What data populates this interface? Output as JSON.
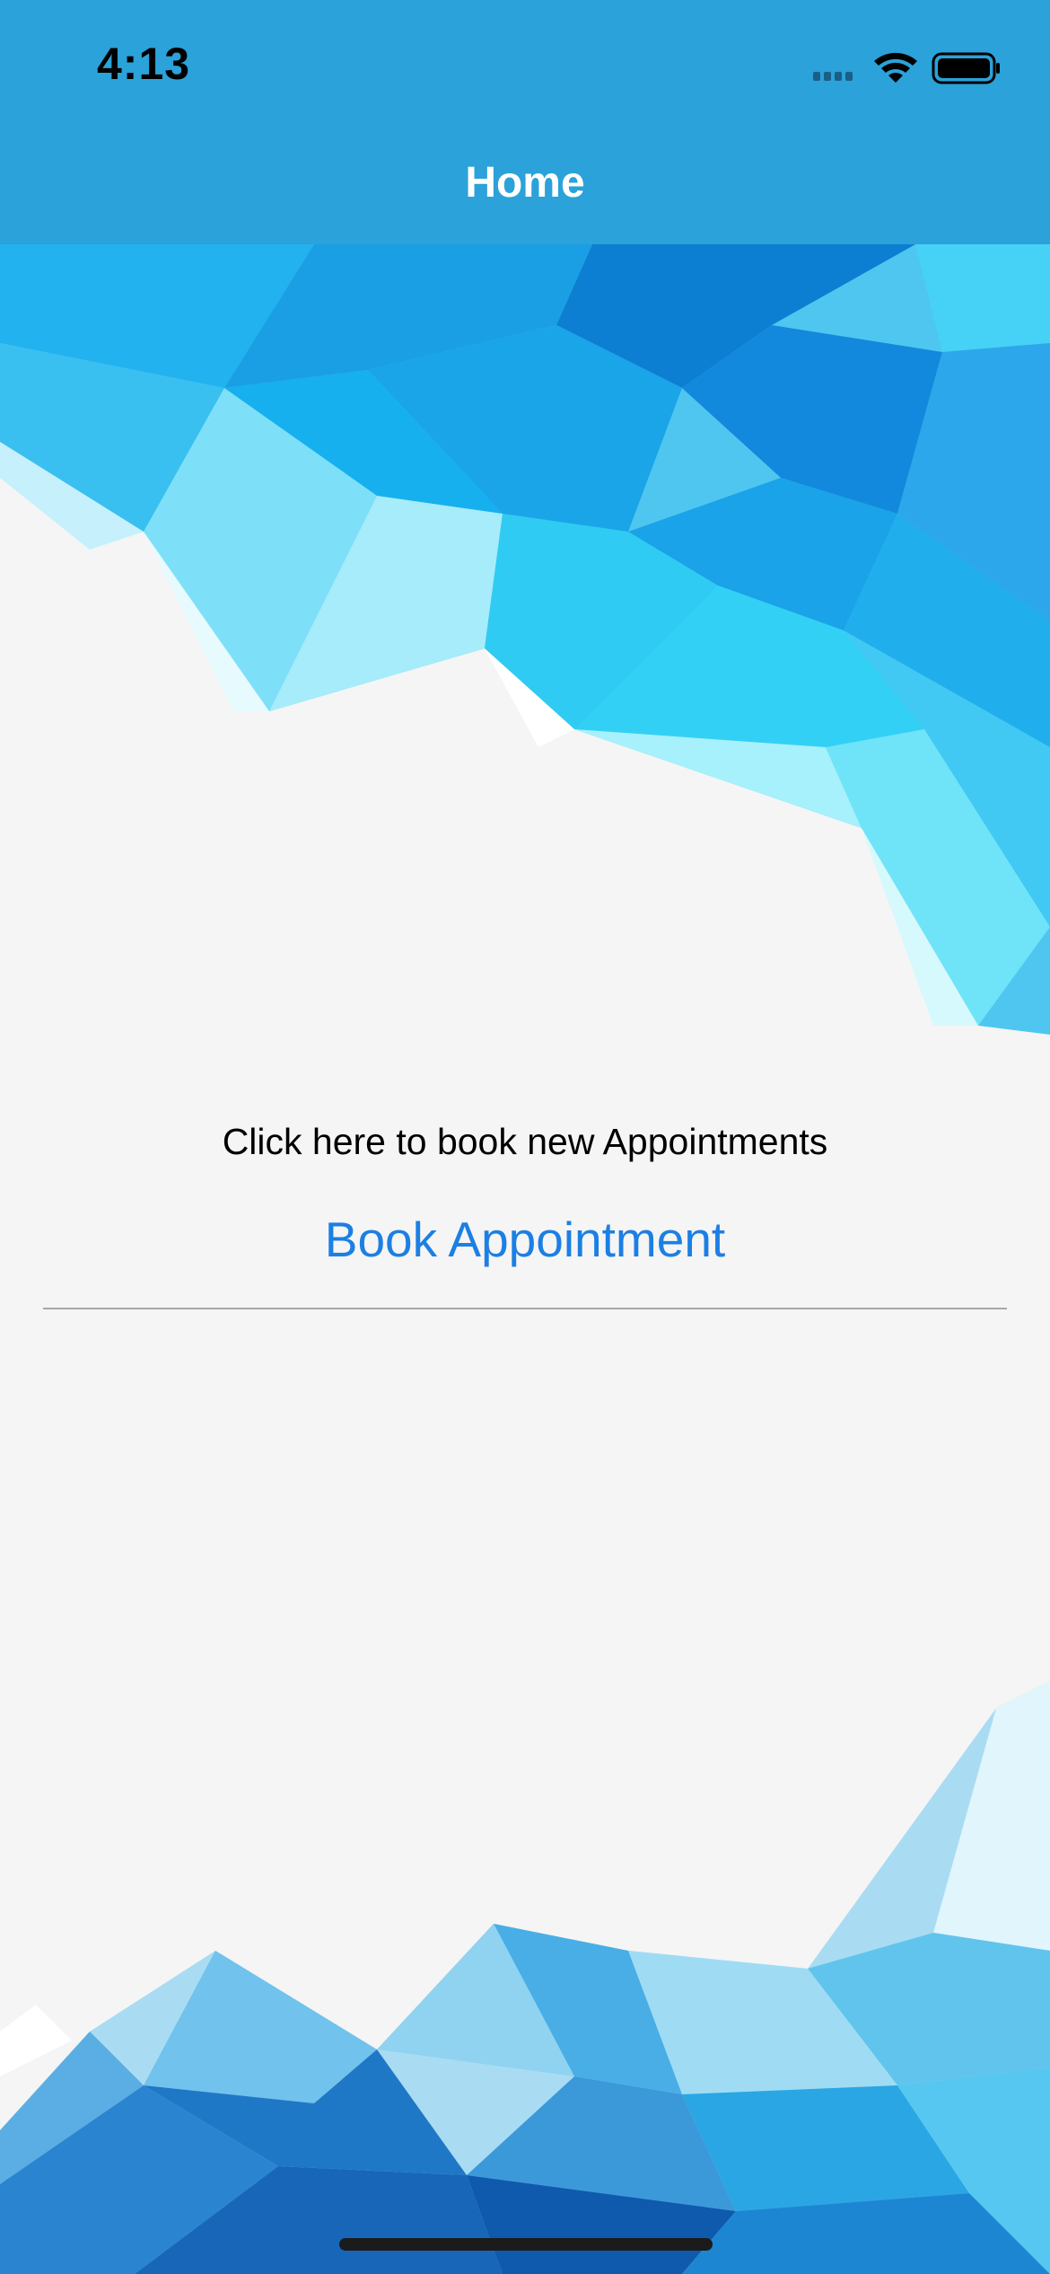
{
  "status_bar": {
    "time": "4:13",
    "icons": [
      "signal-icon",
      "wifi-icon",
      "battery-icon"
    ]
  },
  "nav": {
    "title": "Home"
  },
  "main": {
    "prompt": "Click here to book new Appointments",
    "book_button_label": "Book Appointment"
  },
  "colors": {
    "nav_background": "#2ba2d9",
    "link_blue": "#1c7fe3",
    "page_background": "#f5f5f5"
  }
}
